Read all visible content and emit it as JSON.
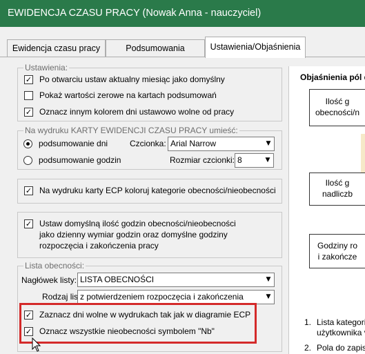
{
  "window": {
    "title": "EWIDENCJA CZASU PRACY  (Nowak Anna - nauczyciel)"
  },
  "tabs": [
    {
      "label": "Ewidencja czasu pracy",
      "active": false
    },
    {
      "label": "Podsumowania",
      "active": false
    },
    {
      "label": "Ustawienia/Objaśnienia",
      "active": true
    }
  ],
  "settings": {
    "title": "Ustawienia:",
    "items": [
      {
        "label": "Po otwarciu ustaw aktualny miesiąc jako domyślny",
        "checked": true
      },
      {
        "label": "Pokaż wartości zerowe na kartach podsumowań",
        "checked": false
      },
      {
        "label": "Oznacz innym kolorem dni ustawowo wolne od pracy",
        "checked": true
      }
    ]
  },
  "print_group": {
    "title": "Na wydruku KARTY EWIDENCJI CZASU PRACY umieść:",
    "radio_days": "podsumowanie dni",
    "radio_hours": "podsumowanie godzin",
    "selected": "podsumowanie dni",
    "font_label": "Czcionka:",
    "font_value": "Arial Narrow",
    "font_size_label": "Rozmiar czcionki:",
    "font_size_value": "8"
  },
  "color_categories": {
    "label": "Na wydruku karty ECP koloruj kategorie obecności/nieobecności",
    "checked": true
  },
  "default_hours": {
    "checked": true,
    "line1": "Ustaw domyślną ilość godzin obecności/nieobecności",
    "line2": "jako dzienny wymiar godzin oraz domyślne godziny",
    "line3": "rozpoczęcia i zakończenia pracy"
  },
  "attendance_list": {
    "title": "Lista obecności:",
    "header_label": "Nagłówek listy:",
    "header_value": "LISTA OBECNOŚCI",
    "type_label": "Rodzaj listy:",
    "type_value": "z potwierdzeniem rozpoczęcia i zakończenia",
    "mark_days_off": {
      "label": "Zaznacz dni wolne w wydrukach tak jak w diagramie ECP",
      "checked": true
    },
    "mark_absences": {
      "label": "Oznacz wszystkie nieobecności symbolem \"Nb\"",
      "checked": true
    }
  },
  "explanations": {
    "title": "Objaśnienia pól di",
    "box1_line1": "Ilość g",
    "box1_line2": "obecności/n",
    "box2_line1": "Ilość g",
    "box2_line2": "nadliczb",
    "box3_line1": "Godziny ro",
    "box3_line2": "i zakończe",
    "note1_num": "1.",
    "note1_line1": "Lista kategori",
    "note1_line2": "użytkownika v",
    "note2_num": "2.",
    "note2_line1": "Pola do zapis"
  },
  "colors": {
    "titlebar": "#2a7a4a",
    "highlight": "#d42a2a",
    "accent_yellow": "#f6e9c8"
  }
}
